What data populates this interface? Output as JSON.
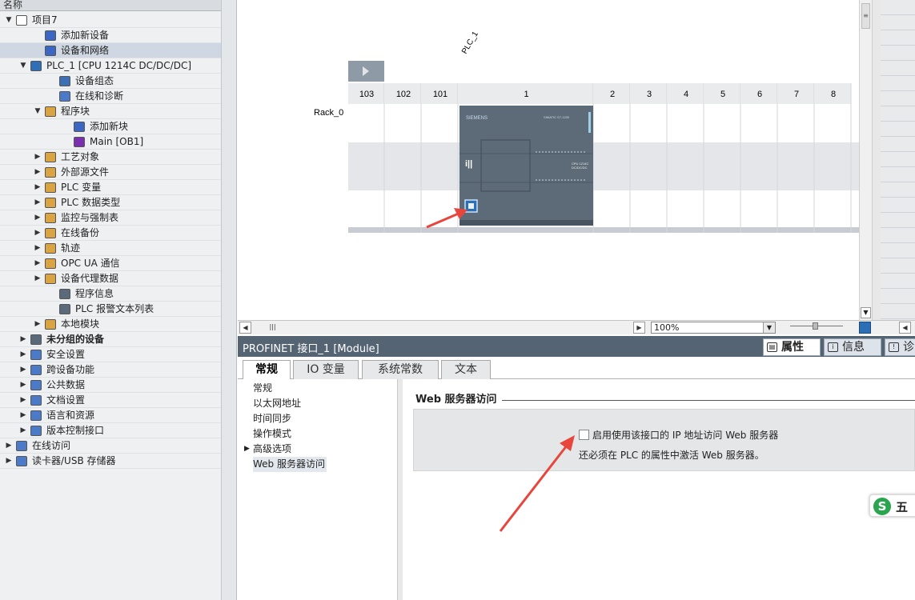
{
  "tree": {
    "header": "名称",
    "items": [
      {
        "label": "项目7",
        "depth": 0,
        "arrow": "open",
        "icon": "project",
        "color": "#ffffff"
      },
      {
        "label": "添加新设备",
        "depth": 2,
        "arrow": "",
        "icon": "add-device",
        "color": "#3b66c4"
      },
      {
        "label": "设备和网络",
        "depth": 2,
        "arrow": "",
        "icon": "network",
        "color": "#3b66c4",
        "selected": true
      },
      {
        "label": "PLC_1 [CPU 1214C DC/DC/DC]",
        "depth": 1,
        "arrow": "open",
        "icon": "plc",
        "color": "#2e6fb8",
        "bold": false
      },
      {
        "label": "设备组态",
        "depth": 3,
        "arrow": "",
        "icon": "device-config",
        "color": "#3c6fb4"
      },
      {
        "label": "在线和诊断",
        "depth": 3,
        "arrow": "",
        "icon": "diagnostics",
        "color": "#4a7ac8"
      },
      {
        "label": "程序块",
        "depth": 2,
        "arrow": "open",
        "icon": "folder",
        "color": "#d9a441"
      },
      {
        "label": "添加新块",
        "depth": 4,
        "arrow": "",
        "icon": "add-block",
        "color": "#3b66c4"
      },
      {
        "label": "Main [OB1]",
        "depth": 4,
        "arrow": "",
        "icon": "ob-block",
        "color": "#7a2fb0"
      },
      {
        "label": "工艺对象",
        "depth": 2,
        "arrow": "closed",
        "icon": "folder",
        "color": "#d9a441"
      },
      {
        "label": "外部源文件",
        "depth": 2,
        "arrow": "closed",
        "icon": "folder",
        "color": "#d9a441"
      },
      {
        "label": "PLC 变量",
        "depth": 2,
        "arrow": "closed",
        "icon": "folder",
        "color": "#d9a441"
      },
      {
        "label": "PLC 数据类型",
        "depth": 2,
        "arrow": "closed",
        "icon": "folder",
        "color": "#d9a441"
      },
      {
        "label": "监控与强制表",
        "depth": 2,
        "arrow": "closed",
        "icon": "folder",
        "color": "#d9a441"
      },
      {
        "label": "在线备份",
        "depth": 2,
        "arrow": "closed",
        "icon": "folder",
        "color": "#d9a441"
      },
      {
        "label": "轨迹",
        "depth": 2,
        "arrow": "closed",
        "icon": "folder",
        "color": "#d9a441"
      },
      {
        "label": "OPC UA 通信",
        "depth": 2,
        "arrow": "closed",
        "icon": "folder",
        "color": "#d9a441"
      },
      {
        "label": "设备代理数据",
        "depth": 2,
        "arrow": "closed",
        "icon": "folder",
        "color": "#d9a441"
      },
      {
        "label": "程序信息",
        "depth": 3,
        "arrow": "",
        "icon": "program-info",
        "color": "#5a6a7a"
      },
      {
        "label": "PLC 报警文本列表",
        "depth": 3,
        "arrow": "",
        "icon": "text-list",
        "color": "#5a6a7a"
      },
      {
        "label": "本地模块",
        "depth": 2,
        "arrow": "closed",
        "icon": "folder",
        "color": "#d9a441"
      },
      {
        "label": "未分组的设备",
        "depth": 1,
        "arrow": "closed",
        "icon": "ungrouped",
        "color": "#5a6a7a",
        "bold": true
      },
      {
        "label": "安全设置",
        "depth": 1,
        "arrow": "closed",
        "icon": "security",
        "color": "#4a7ac8"
      },
      {
        "label": "跨设备功能",
        "depth": 1,
        "arrow": "closed",
        "icon": "cross-device",
        "color": "#4a7ac8"
      },
      {
        "label": "公共数据",
        "depth": 1,
        "arrow": "closed",
        "icon": "common-data",
        "color": "#4a7ac8"
      },
      {
        "label": "文档设置",
        "depth": 1,
        "arrow": "closed",
        "icon": "document",
        "color": "#4a7ac8"
      },
      {
        "label": "语言和资源",
        "depth": 1,
        "arrow": "closed",
        "icon": "language",
        "color": "#4a7ac8"
      },
      {
        "label": "版本控制接口",
        "depth": 1,
        "arrow": "closed",
        "icon": "version-control",
        "color": "#4a7ac8"
      },
      {
        "label": "在线访问",
        "depth": 0,
        "arrow": "closed",
        "icon": "online-access",
        "color": "#4a7ac8"
      },
      {
        "label": "读卡器/USB 存储器",
        "depth": 0,
        "arrow": "closed",
        "icon": "card-reader",
        "color": "#4a7ac8"
      }
    ]
  },
  "canvas": {
    "device_label": "PLC_1",
    "rack_label": "Rack_0",
    "slots": [
      "103",
      "102",
      "101",
      "1",
      "2",
      "3",
      "4",
      "5",
      "6",
      "7",
      "8"
    ],
    "cpu_brand": "SIEMENS",
    "cpu_model_text": "SIMATIC S7-1200",
    "cpu_short": "CPU 1214C",
    "cpu_power": "DC/DC/DC"
  },
  "toolbar": {
    "zoom": "100%"
  },
  "properties": {
    "title": "PROFINET 接口_1 [Module]",
    "right_tabs": [
      {
        "label": "属性",
        "icon": "properties-icon",
        "active": true
      },
      {
        "label": "信息",
        "icon": "info-icon",
        "active": false
      },
      {
        "label": "诊",
        "icon": "diagnostics-icon",
        "active": false
      }
    ],
    "tabs": [
      "常规",
      "IO 变量",
      "系统常数",
      "文本"
    ],
    "nav": [
      "常规",
      "以太网地址",
      "时间同步",
      "操作模式",
      "高级选项",
      "Web 服务器访问"
    ],
    "section_title": "Web 服务器访问",
    "checkbox_label": "启用使用该接口的 IP 地址访问 Web 服务器",
    "note": "还必须在 PLC 的属性中激活 Web 服务器。",
    "checkbox_checked": false
  },
  "ime": {
    "badge": "S",
    "label": "五"
  },
  "colors": {
    "accent_arrow": "#e8453c",
    "title_bar": "#556473",
    "cpu_body": "#5d6b78"
  }
}
